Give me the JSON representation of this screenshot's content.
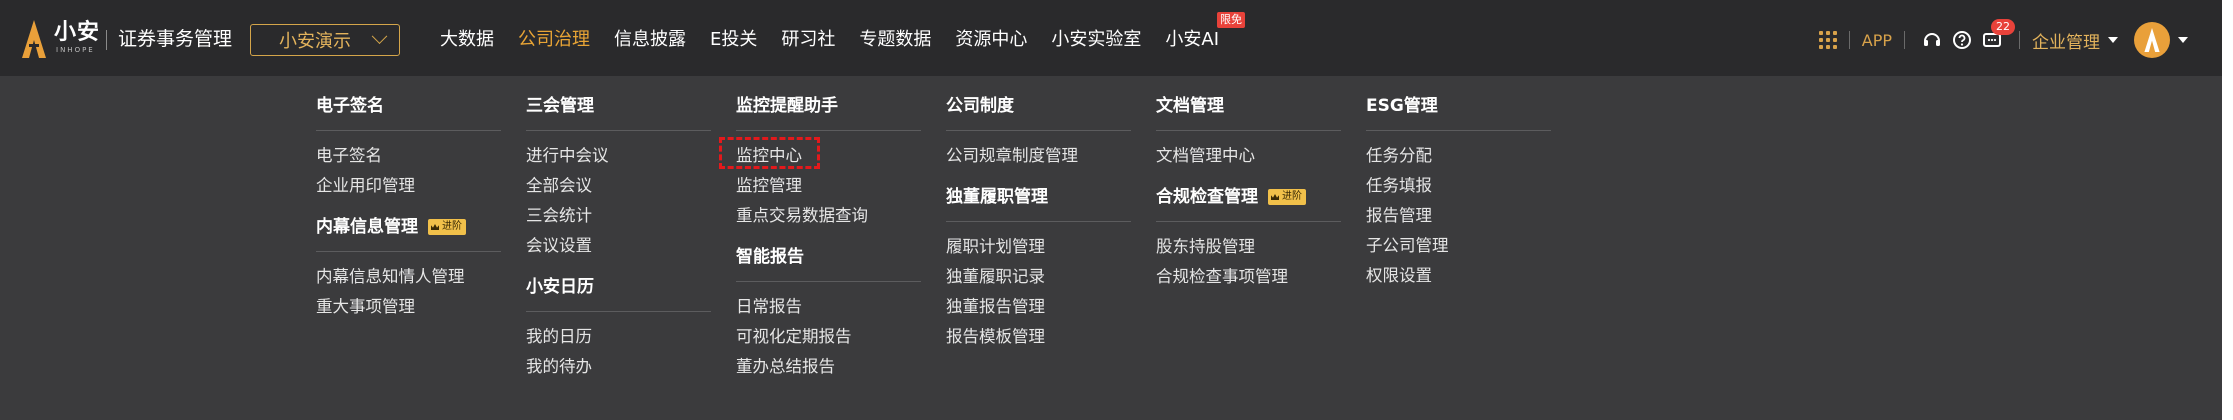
{
  "header": {
    "logo_cn": "小安",
    "logo_en": "INHOPE",
    "product_name": "证券事务管理",
    "company_select": "小安演示",
    "nav": [
      {
        "label": "大数据",
        "active": false
      },
      {
        "label": "公司治理",
        "active": true
      },
      {
        "label": "信息披露",
        "active": false
      },
      {
        "label": "E投关",
        "active": false
      },
      {
        "label": "研习社",
        "active": false
      },
      {
        "label": "专题数据",
        "active": false
      },
      {
        "label": "资源中心",
        "active": false
      },
      {
        "label": "小安实验室",
        "active": false
      },
      {
        "label": "小安AI",
        "active": false,
        "badge": "限免"
      }
    ],
    "tools": {
      "app_label": "APP",
      "notification_count": "22",
      "enterprise_menu": "企业管理"
    }
  },
  "menu": {
    "adv_tag": "进阶",
    "col1": {
      "s1": {
        "title": "电子签名",
        "items": [
          "电子签名",
          "企业用印管理"
        ]
      },
      "s2": {
        "title": "内幕信息管理",
        "items": [
          "内幕信息知情人管理",
          "重大事项管理"
        ]
      }
    },
    "col2": {
      "s1": {
        "title": "三会管理",
        "items": [
          "进行中会议",
          "全部会议",
          "三会统计",
          "会议设置"
        ]
      },
      "s2": {
        "title": "小安日历",
        "items": [
          "我的日历",
          "我的待办"
        ]
      }
    },
    "col3": {
      "s1": {
        "title": "监控提醒助手",
        "items": [
          "监控中心",
          "监控管理",
          "重点交易数据查询"
        ]
      },
      "s2": {
        "title": "智能报告",
        "items": [
          "日常报告",
          "可视化定期报告",
          "董办总结报告"
        ]
      }
    },
    "col4": {
      "s1": {
        "title": "公司制度",
        "items": [
          "公司规章制度管理"
        ]
      },
      "s2": {
        "title": "独董履职管理",
        "items": [
          "履职计划管理",
          "独董履职记录",
          "独董报告管理",
          "报告模板管理"
        ]
      }
    },
    "col5": {
      "s1": {
        "title": "文档管理",
        "items": [
          "文档管理中心"
        ]
      },
      "s2": {
        "title": "合规检查管理",
        "items": [
          "股东持股管理",
          "合规检查事项管理"
        ]
      }
    },
    "col6": {
      "s1": {
        "title": "ESG管理",
        "items": [
          "任务分配",
          "任务填报",
          "报告管理",
          "子公司管理",
          "权限设置"
        ]
      }
    }
  },
  "colors": {
    "topbar": "#2a2a2c",
    "menu_bg": "#3b3b3d",
    "accent": "#e8a435",
    "highlight_border": "#e3191c"
  }
}
